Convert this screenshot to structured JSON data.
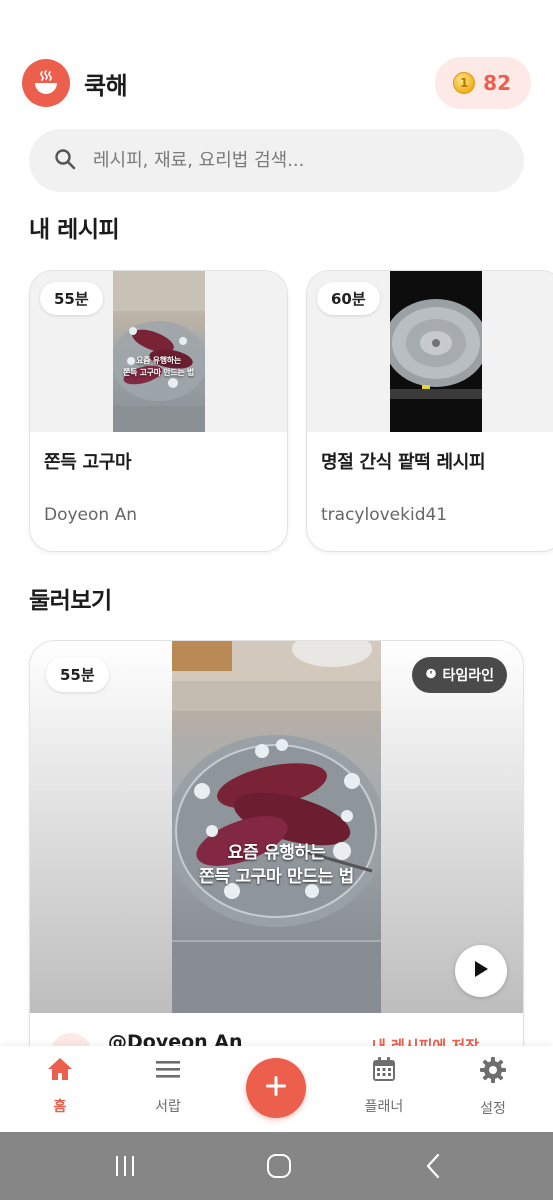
{
  "app": {
    "title": "쿡해",
    "points": "82",
    "accent_color": "#ec5f4c",
    "logo_icon": "rice-bowl-icon",
    "coin_icon": "coin-icon"
  },
  "search": {
    "placeholder": "레시피, 재료, 요리법 검색..."
  },
  "my_recipes": {
    "title": "내 레시피",
    "items": [
      {
        "time": "55분",
        "title": "쫀득 고구마",
        "author": "Doyeon An",
        "overlay_line1": "요즘 유행하는",
        "overlay_line2": "쫀득 고구마 만드는 법"
      },
      {
        "time": "60분",
        "title": "명절 간식 팥떡 레시피",
        "author": "tracylovekid41"
      }
    ]
  },
  "explore": {
    "title": "둘러보기",
    "card": {
      "time": "55분",
      "timeline_label": "타임라인",
      "overlay_line1": "요즘 유행하는",
      "overlay_line2": "쫀득 고구마 만드는 법",
      "author": "@Doyeon An",
      "action_label": "내 레시피에 저장"
    }
  },
  "nav": {
    "home": "홈",
    "library": "서랍",
    "planner": "플래너",
    "settings": "설정"
  }
}
